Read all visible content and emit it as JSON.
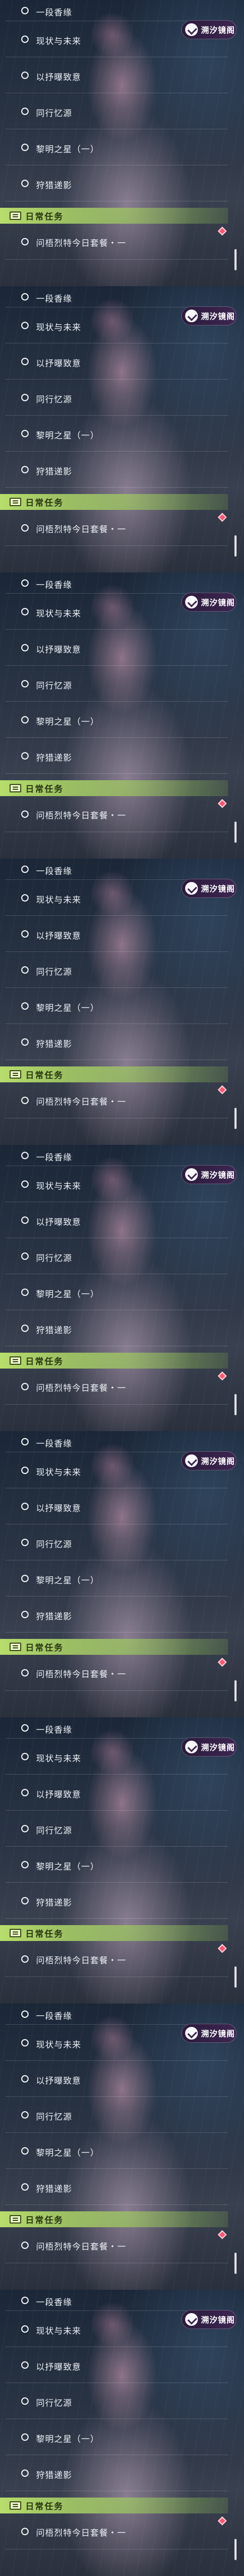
{
  "quests": [
    "一段香缘",
    "现状与未来",
    "以抒曝致意",
    "同行忆源",
    "黎明之星（一）",
    "狩猎递影"
  ],
  "chat_badge_label": "溯汐镜阁",
  "daily_section_label": "日常任务",
  "daily_quest_label": "问梧烈特今日套餐・一",
  "colors": {
    "banner_green": "#bee66e",
    "badge_purple": "#3d2651",
    "diamond_red": "#ff5570"
  },
  "icons": {
    "quest_marker": "hollow-circle",
    "chat_badge": "chat-bubble-check",
    "daily_section": "task-card",
    "pin": "red-diamond"
  }
}
